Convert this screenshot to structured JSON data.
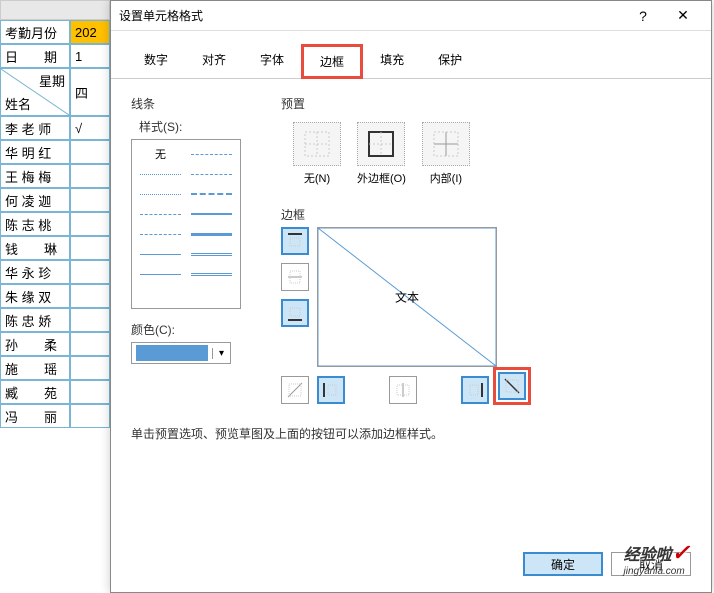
{
  "sheet": {
    "rows": [
      {
        "a": "考勤月份",
        "b": "202",
        "highlight": true
      },
      {
        "a": "日　　期",
        "b": "1"
      },
      {
        "a_header": {
          "top": "星期",
          "bottom": "姓名"
        },
        "b": "四"
      },
      {
        "a": "李 老 师",
        "b": "√"
      },
      {
        "a": "华 明 红",
        "b": ""
      },
      {
        "a": "王 梅 梅",
        "b": ""
      },
      {
        "a": "何 凌 迦",
        "b": ""
      },
      {
        "a": "陈 志 桃",
        "b": ""
      },
      {
        "a": "钱　　琳",
        "b": ""
      },
      {
        "a": "华 永 珍",
        "b": ""
      },
      {
        "a": "朱 缘 双",
        "b": ""
      },
      {
        "a": "陈 忠 娇",
        "b": ""
      },
      {
        "a": "孙　　柔",
        "b": ""
      },
      {
        "a": "施　　瑶",
        "b": ""
      },
      {
        "a": "臧　　苑",
        "b": ""
      },
      {
        "a": "冯　　丽",
        "b": ""
      }
    ]
  },
  "dialog": {
    "title": "设置单元格格式",
    "help": "?",
    "close": "✕",
    "tabs": [
      "数字",
      "对齐",
      "字体",
      "边框",
      "填充",
      "保护"
    ],
    "active_tab": 3,
    "line_section": "线条",
    "style_label": "样式(S):",
    "style_none": "无",
    "color_label": "颜色(C):",
    "preset_section": "预置",
    "presets": [
      {
        "label": "无(N)"
      },
      {
        "label": "外边框(O)"
      },
      {
        "label": "内部(I)"
      }
    ],
    "border_section": "边框",
    "preview_text": "文本",
    "hint": "单击预置选项、预览草图及上面的按钮可以添加边框样式。",
    "ok": "确定",
    "cancel": "取消"
  },
  "watermark": {
    "main": "经验啦",
    "sub": "jingyanla.com"
  }
}
